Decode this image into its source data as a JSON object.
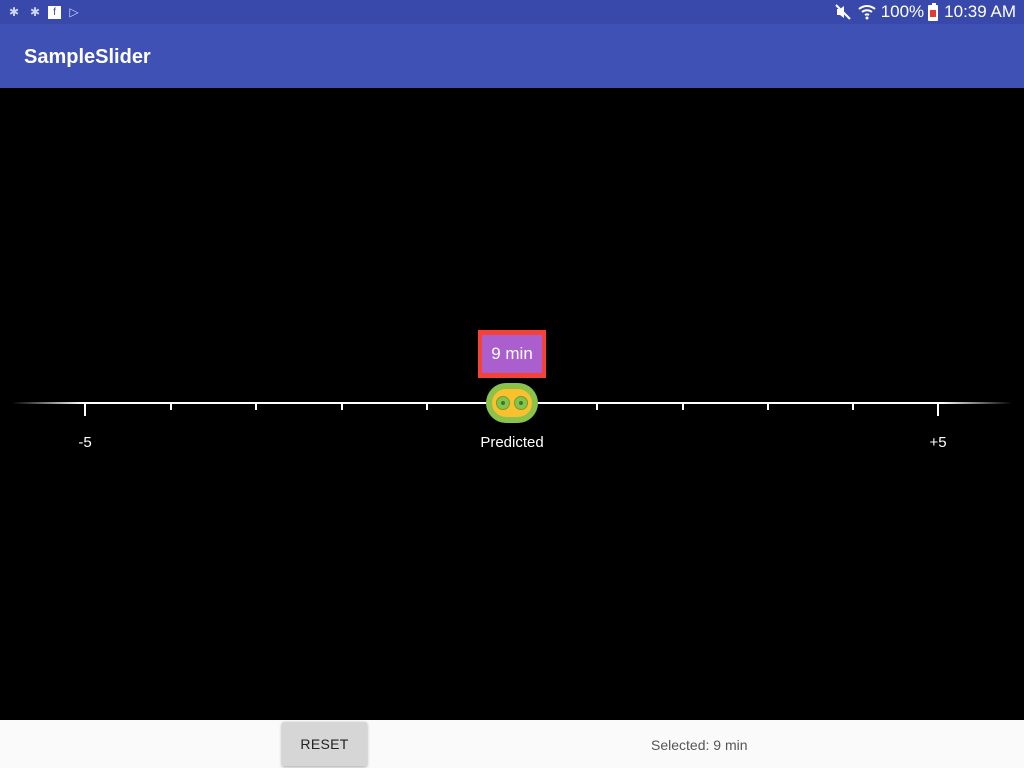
{
  "statusbar": {
    "battery_pct": "100%",
    "time": "10:39 AM",
    "icons": [
      "notification-icon",
      "notification-icon",
      "flipboard-icon",
      "play-store-icon",
      "mute-icon",
      "wifi-icon",
      "battery-icon"
    ]
  },
  "appbar": {
    "title": "SampleSlider"
  },
  "slider": {
    "min_label": "-5",
    "center_label": "Predicted",
    "max_label": "+5",
    "bubble_text": "9 min",
    "value": 0,
    "min": -5,
    "max": 5
  },
  "footer": {
    "reset_label": "RESET",
    "selected_text": "Selected: 9 min"
  },
  "colors": {
    "statusbar": "#3949ab",
    "appbar": "#3f51b5",
    "bubble_border": "#f44336",
    "bubble_fill": "#ab5fcf",
    "thumb_outer": "#8bc34a",
    "thumb_inner": "#fbc02d"
  }
}
